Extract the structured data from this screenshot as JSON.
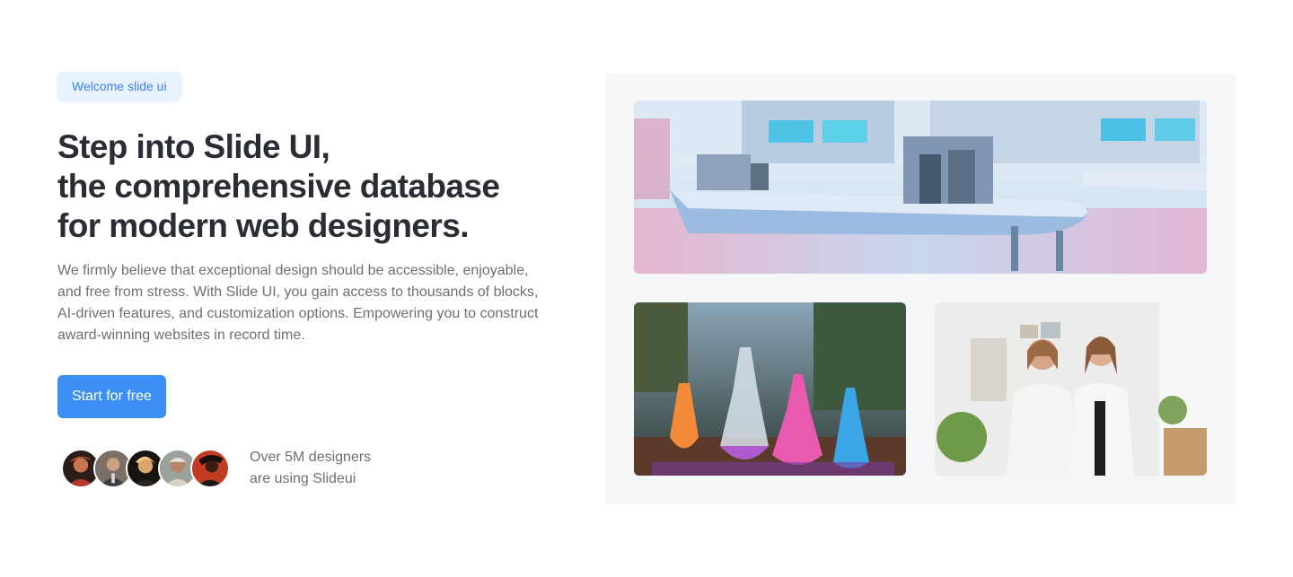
{
  "hero": {
    "badge": "Welcome slide ui",
    "title_lines": [
      "Step into Slide UI,",
      "the comprehensive database",
      "for modern web designers."
    ],
    "description": "We firmly believe that exceptional design should be accessible, enjoyable, and free from stress. With Slide UI, you gain access to thousands of blocks, AI-driven features, and customization options. Empowering you to construct award-winning websites in record time.",
    "cta_label": "Start for free"
  },
  "social_proof": {
    "line1": "Over 5M designers",
    "line2": "are using Slideui",
    "avatar_count": 5
  },
  "gallery": {
    "images": [
      "laboratory-interior-photo",
      "colorful-flasks-photo",
      "two-scientists-photo"
    ]
  },
  "colors": {
    "accent": "#3b8ff6",
    "badge_bg": "#e8f2ff",
    "badge_text": "#3b82f6",
    "heading": "#2a2d33",
    "body_text": "#6b7075",
    "gallery_bg": "#f5f6f8"
  }
}
